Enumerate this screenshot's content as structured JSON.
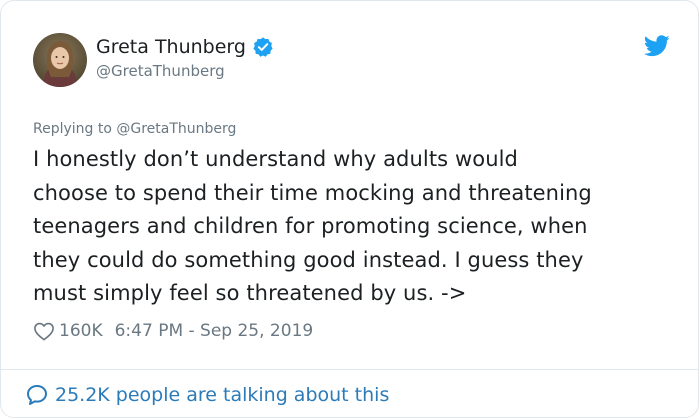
{
  "author": {
    "display_name": "Greta Thunberg",
    "handle": "@GretaThunberg",
    "verified": true
  },
  "tweet": {
    "replying_to": "Replying to @GretaThunberg",
    "lines": [
      "I honestly don’t understand why adults would",
      "choose to spend their time mocking and threatening",
      "teenagers and children for promoting science, when",
      "they could do something good instead. I guess they",
      "must simply feel so threatened by us. ->"
    ],
    "likes": "160K",
    "timestamp": "6:47 PM - Sep 25, 2019"
  },
  "footer": {
    "talking_label": "25.2K people are talking about this"
  },
  "icons": {
    "verified": "verified-badge-icon",
    "brand": "twitter-bird-icon",
    "like": "heart-icon",
    "conversation": "speech-bubble-icon"
  },
  "colors": {
    "twitter_blue": "#1da1f2",
    "link_blue": "#2b7bb9",
    "secondary_text": "#697882",
    "primary_text": "#1c2022",
    "border": "#e1e8ed"
  }
}
